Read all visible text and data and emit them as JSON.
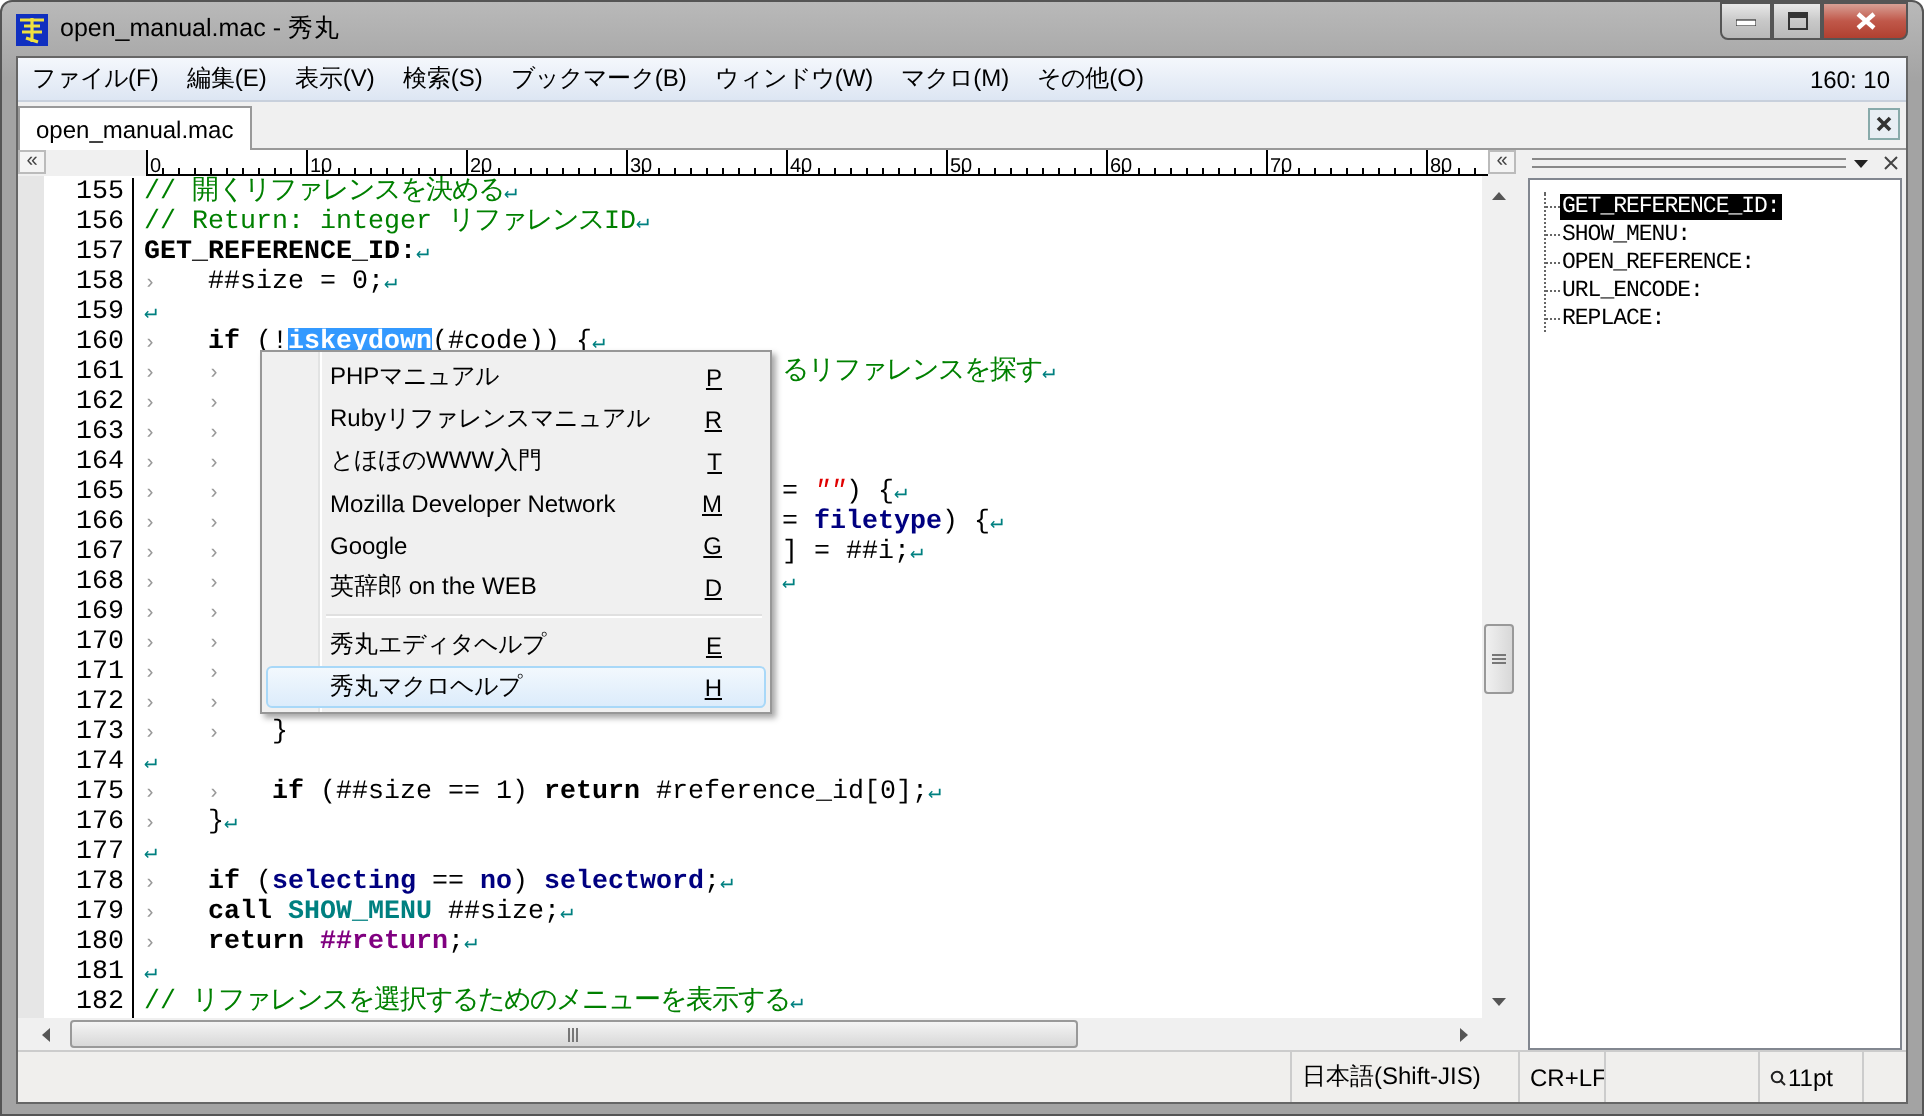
{
  "window": {
    "title": "open_manual.mac  - 秀丸"
  },
  "menu_bar": {
    "items": [
      "ファイル(F)",
      "編集(E)",
      "表示(V)",
      "検索(S)",
      "ブックマーク(B)",
      "ウィンドウ(W)",
      "マクロ(M)",
      "その他(O)"
    ],
    "position": "160: 10"
  },
  "tabs": [
    {
      "label": "open_manual.mac",
      "selected": true
    }
  ],
  "ruler": {
    "left_button": "«",
    "right_button": "«",
    "labels": [
      "0",
      "10",
      "20",
      "30",
      "40",
      "50",
      "60",
      "70",
      "80"
    ]
  },
  "lines": [
    {
      "number": "155",
      "tokens": [
        {
          "text": "// 開くリファレンスを決める",
          "kind": "comment"
        },
        {
          "text": "↵",
          "kind": "eol"
        }
      ]
    },
    {
      "number": "156",
      "tokens": [
        {
          "text": "// Return: integer リファレンスID",
          "kind": "comment"
        },
        {
          "text": "↵",
          "kind": "eol"
        }
      ]
    },
    {
      "number": "157",
      "tokens": [
        {
          "text": "GET_REFERENCE_ID:",
          "kind": "keyword"
        },
        {
          "text": "↵",
          "kind": "eol"
        }
      ]
    },
    {
      "number": "158",
      "tokens": [
        {
          "text": "›",
          "kind": "tab"
        },
        {
          "text": "##size = 0;",
          "kind": "plain"
        },
        {
          "text": "↵",
          "kind": "eol"
        }
      ]
    },
    {
      "number": "159",
      "tokens": [
        {
          "text": "↵",
          "kind": "eol"
        }
      ]
    },
    {
      "number": "160",
      "tokens": [
        {
          "text": "›",
          "kind": "tab"
        },
        {
          "text": "if",
          "kind": "keyword"
        },
        {
          "text": " (!",
          "kind": "plain"
        },
        {
          "text": "iskeydown",
          "kind": "selected"
        },
        {
          "text": "(#code)) {",
          "kind": "plain"
        },
        {
          "text": "↵",
          "kind": "eol"
        }
      ]
    },
    {
      "number": "161",
      "tokens": [
        {
          "text": "›",
          "kind": "tab"
        },
        {
          "text": "›",
          "kind": "tab"
        }
      ],
      "tail": [
        {
          "text": "るリファレンスを探す",
          "kind": "comment"
        },
        {
          "text": "↵",
          "kind": "eol"
        }
      ]
    },
    {
      "number": "162",
      "tokens": [
        {
          "text": "›",
          "kind": "tab"
        },
        {
          "text": "›",
          "kind": "tab"
        }
      ]
    },
    {
      "number": "163",
      "tokens": [
        {
          "text": "›",
          "kind": "tab"
        },
        {
          "text": "›",
          "kind": "tab"
        }
      ]
    },
    {
      "number": "164",
      "tokens": [
        {
          "text": "›",
          "kind": "tab"
        },
        {
          "text": "›",
          "kind": "tab"
        }
      ]
    },
    {
      "number": "165",
      "tokens": [
        {
          "text": "›",
          "kind": "tab"
        },
        {
          "text": "›",
          "kind": "tab"
        }
      ],
      "tail": [
        {
          "text": "= ",
          "kind": "plain"
        },
        {
          "text": "\"\"",
          "kind": "string"
        },
        {
          "text": ") {",
          "kind": "plain"
        },
        {
          "text": "↵",
          "kind": "eol"
        }
      ]
    },
    {
      "number": "166",
      "tokens": [
        {
          "text": "›",
          "kind": "tab"
        },
        {
          "text": "›",
          "kind": "tab"
        }
      ],
      "tail": [
        {
          "text": "= ",
          "kind": "plain"
        },
        {
          "text": "filetype",
          "kind": "variable"
        },
        {
          "text": ") {",
          "kind": "plain"
        },
        {
          "text": "↵",
          "kind": "eol"
        }
      ]
    },
    {
      "number": "167",
      "tokens": [
        {
          "text": "›",
          "kind": "tab"
        },
        {
          "text": "›",
          "kind": "tab"
        }
      ],
      "tail": [
        {
          "text": "] = ##i;",
          "kind": "plain"
        },
        {
          "text": "↵",
          "kind": "eol"
        }
      ]
    },
    {
      "number": "168",
      "tokens": [
        {
          "text": "›",
          "kind": "tab"
        },
        {
          "text": "›",
          "kind": "tab"
        }
      ],
      "tail": [
        {
          "text": "↵",
          "kind": "eol"
        }
      ]
    },
    {
      "number": "169",
      "tokens": [
        {
          "text": "›",
          "kind": "tab"
        },
        {
          "text": "›",
          "kind": "tab"
        }
      ]
    },
    {
      "number": "170",
      "tokens": [
        {
          "text": "›",
          "kind": "tab"
        },
        {
          "text": "›",
          "kind": "tab"
        }
      ]
    },
    {
      "number": "171",
      "tokens": [
        {
          "text": "›",
          "kind": "tab"
        },
        {
          "text": "›",
          "kind": "tab"
        }
      ]
    },
    {
      "number": "172",
      "tokens": [
        {
          "text": "›",
          "kind": "tab"
        },
        {
          "text": "›",
          "kind": "tab"
        }
      ]
    },
    {
      "number": "173",
      "tokens": [
        {
          "text": "›",
          "kind": "tab"
        },
        {
          "text": "›",
          "kind": "tab"
        },
        {
          "text": "}",
          "kind": "plain"
        }
      ]
    },
    {
      "number": "174",
      "tokens": [
        {
          "text": "↵",
          "kind": "eol"
        }
      ]
    },
    {
      "number": "175",
      "tokens": [
        {
          "text": "›",
          "kind": "tab"
        },
        {
          "text": "›",
          "kind": "tab"
        },
        {
          "text": "if",
          "kind": "keyword"
        },
        {
          "text": " (##size == 1) ",
          "kind": "plain"
        },
        {
          "text": "return",
          "kind": "keyword"
        },
        {
          "text": " #reference_id[0];",
          "kind": "plain"
        },
        {
          "text": "↵",
          "kind": "eol"
        }
      ]
    },
    {
      "number": "176",
      "tokens": [
        {
          "text": "›",
          "kind": "tab"
        },
        {
          "text": "}",
          "kind": "plain"
        },
        {
          "text": "↵",
          "kind": "eol"
        }
      ]
    },
    {
      "number": "177",
      "tokens": [
        {
          "text": "↵",
          "kind": "eol"
        }
      ]
    },
    {
      "number": "178",
      "tokens": [
        {
          "text": "›",
          "kind": "tab"
        },
        {
          "text": "if",
          "kind": "keyword"
        },
        {
          "text": " (",
          "kind": "plain"
        },
        {
          "text": "selecting",
          "kind": "variable"
        },
        {
          "text": " == ",
          "kind": "plain"
        },
        {
          "text": "no",
          "kind": "variable"
        },
        {
          "text": ") ",
          "kind": "plain"
        },
        {
          "text": "selectword",
          "kind": "variable"
        },
        {
          "text": ";",
          "kind": "plain"
        },
        {
          "text": "↵",
          "kind": "eol"
        }
      ]
    },
    {
      "number": "179",
      "tokens": [
        {
          "text": "›",
          "kind": "tab"
        },
        {
          "text": "call ",
          "kind": "keyword"
        },
        {
          "text": "SHOW_MENU",
          "kind": "label"
        },
        {
          "text": " ##size;",
          "kind": "plain"
        },
        {
          "text": "↵",
          "kind": "eol"
        }
      ]
    },
    {
      "number": "180",
      "tokens": [
        {
          "text": "›",
          "kind": "tab"
        },
        {
          "text": "return ",
          "kind": "keyword"
        },
        {
          "text": "##return",
          "kind": "return_var"
        },
        {
          "text": ";",
          "kind": "plain"
        },
        {
          "text": "↵",
          "kind": "eol"
        }
      ]
    },
    {
      "number": "181",
      "tokens": [
        {
          "text": "↵",
          "kind": "eol"
        }
      ]
    },
    {
      "number": "182",
      "tokens": [
        {
          "text": "// リファレンスを選択するためのメニューを表示する",
          "kind": "comment"
        },
        {
          "text": "↵",
          "kind": "eol"
        }
      ]
    }
  ],
  "context_menu": {
    "items": [
      {
        "kind": "item",
        "label": "PHPマニュアル",
        "key": "P",
        "selected": false
      },
      {
        "kind": "item",
        "label": "Rubyリファレンスマニュアル",
        "key": "R",
        "selected": false
      },
      {
        "kind": "item",
        "label": "とほほのWWW入門",
        "key": "T",
        "selected": false
      },
      {
        "kind": "item",
        "label": "Mozilla Developer Network",
        "key": "M",
        "selected": false
      },
      {
        "kind": "item",
        "label": "Google",
        "key": "G",
        "selected": false
      },
      {
        "kind": "item",
        "label": "英辞郎 on the WEB",
        "key": "D",
        "selected": false
      },
      {
        "kind": "separator"
      },
      {
        "kind": "item",
        "label": "秀丸エディタヘルプ",
        "key": "E",
        "selected": false
      },
      {
        "kind": "item",
        "label": "秀丸マクロヘルプ",
        "key": "H",
        "selected": true
      }
    ]
  },
  "outline": {
    "items": [
      {
        "label": "GET_REFERENCE_ID:",
        "selected": true
      },
      {
        "label": "SHOW_MENU:",
        "selected": false
      },
      {
        "label": "OPEN_REFERENCE:",
        "selected": false
      },
      {
        "label": "URL_ENCODE:",
        "selected": false
      },
      {
        "label": "REPLACE:",
        "selected": false
      }
    ]
  },
  "status_bar": {
    "encoding": "日本語(Shift-JIS)",
    "line_ending": "CR+LF",
    "zoom": "11pt"
  }
}
